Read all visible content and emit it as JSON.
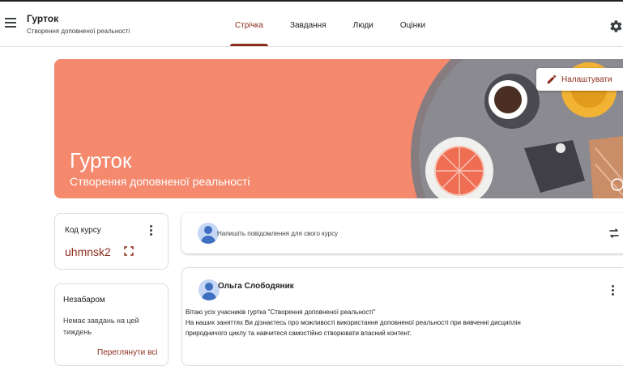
{
  "header": {
    "class_title": "Гурток",
    "class_subtitle": "Створення доповненої реальності",
    "tabs": [
      {
        "label": "Стрічка",
        "active": true
      },
      {
        "label": "Завдання",
        "active": false
      },
      {
        "label": "Люди",
        "active": false
      },
      {
        "label": "Оцінки",
        "active": false
      }
    ],
    "icons": {
      "menu": "menu-icon",
      "settings": "gear-icon"
    }
  },
  "banner": {
    "title": "Гурток",
    "subtitle": "Створення доповненої реальності",
    "customize_label": "Налаштувати",
    "color": "#f4896e"
  },
  "course_code": {
    "label": "Код курсу",
    "value": "uhmnsk2"
  },
  "upcoming": {
    "title": "Незабаром",
    "text": "Немає завдань на цей тиждень",
    "link": "Переглянути всі"
  },
  "composer": {
    "placeholder": "Напишіть повідомлення для свого курсу"
  },
  "post": {
    "author": "Ольга Слободяник",
    "lines": [
      "Вітаю усіх учасників гуртка \"Створення доповненої реальності\"",
      "На наших заняттях Ви дізнаєтесь про можливості використання доповненої реальності при вивченні дисциплін",
      "природничого циклу та навчитеся самостійно створювати власний контент."
    ]
  },
  "colors": {
    "accent": "#8b2c1c",
    "avatar": "#3f6fbf"
  }
}
